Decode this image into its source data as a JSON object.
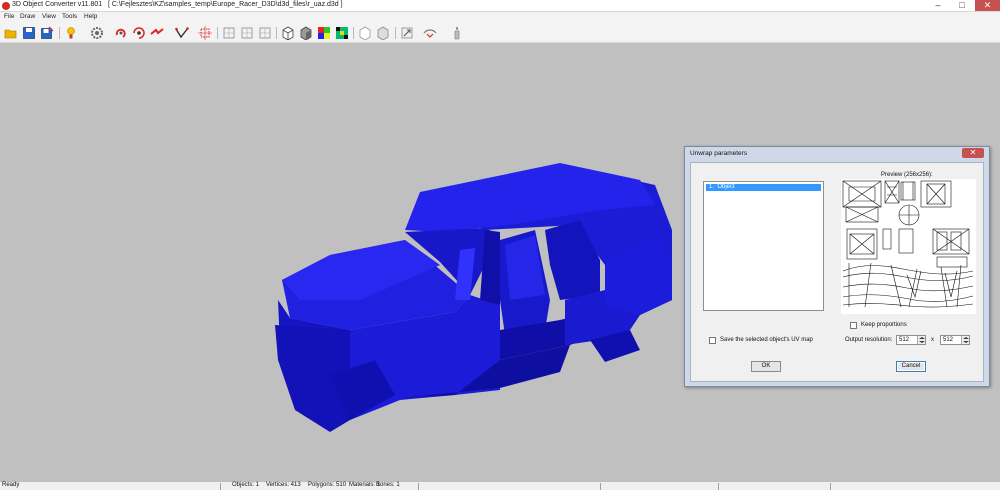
{
  "window": {
    "title": "3D Object Converter v11.801   [ C:\\Fejlesztes\\KZ\\samples_temp\\Europe_Racer_D3D\\d3d_files\\r_uaz.d3d ]",
    "minimize_glyph": "–",
    "maximize_glyph": "□",
    "close_glyph": "✕"
  },
  "menu": {
    "items": [
      "File",
      "Draw",
      "View",
      "Tools",
      "Help"
    ]
  },
  "toolbar": {
    "icons": [
      "open-icon",
      "save-icon",
      "save-as-icon",
      "lightbulb-icon",
      "settings-gear-icon",
      "rotate-icon",
      "rotate-target-icon",
      "move-icon",
      "draw-vertices-icon",
      "bounding-box-icon",
      "view-front-icon",
      "view-side-icon",
      "view-top-icon",
      "wireframe-icon",
      "solid-icon",
      "color-icon",
      "texture-icon",
      "grid-icon",
      "axis-icon",
      "zoom-icon",
      "flip-icon",
      "magic-icon"
    ]
  },
  "status": {
    "left": "Ready",
    "objects": "Objects: 1",
    "vertices": "Vertices: 413",
    "polygons": "Polygons: 510",
    "materials": "Materials: 1",
    "bones": "Bones: 1"
  },
  "dialog": {
    "title": "Unwrap parameters",
    "close_glyph": "✕",
    "object_list": [
      "1.  Object"
    ],
    "preview_label": "Preview (256x256):",
    "keep_proportions_label": "Keep proportions",
    "save_uv_label": "Save the selected object's UV map",
    "output_resolution_label": "Output resolution:",
    "resolution_width": "512",
    "resolution_x": "x",
    "resolution_height": "512",
    "ok_label": "OK",
    "cancel_label": "Cancel"
  },
  "colors": {
    "model": "#1a1ae6",
    "viewport": "#c0c0c0",
    "selection": "#3399ff",
    "close_button": "#c75050"
  }
}
